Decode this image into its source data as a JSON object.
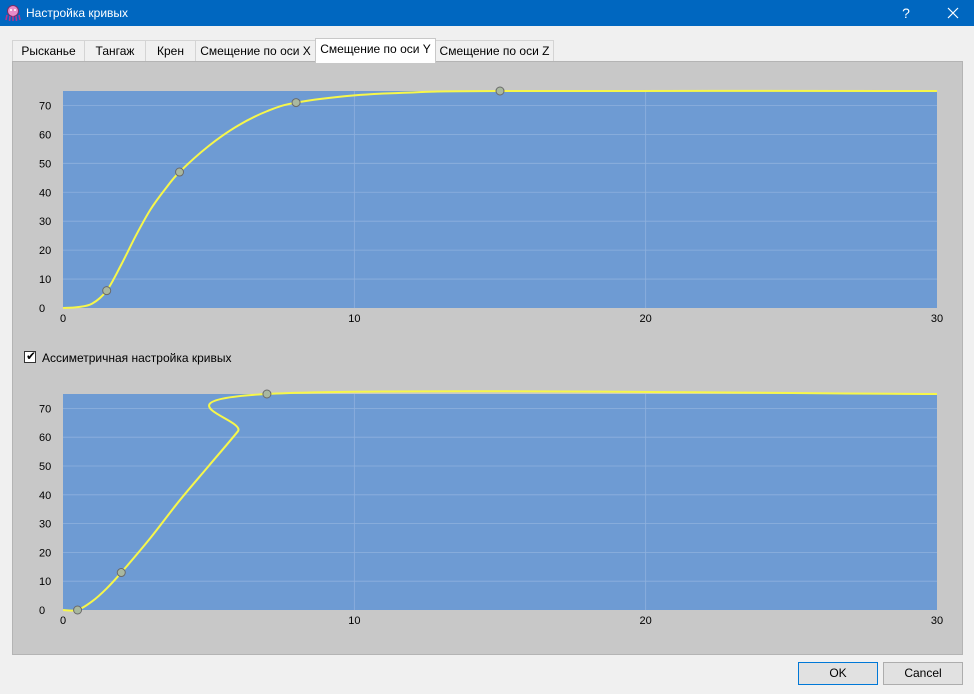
{
  "window": {
    "title": "Настройка кривых",
    "help_label": "?",
    "close_label": "✕"
  },
  "tabs": [
    {
      "label": "Рысканье",
      "active": false
    },
    {
      "label": "Тангаж",
      "active": false
    },
    {
      "label": "Крен",
      "active": false
    },
    {
      "label": "Смещение по оси X",
      "active": false
    },
    {
      "label": "Смещение по оси Y",
      "active": true
    },
    {
      "label": "Смещение по оси Z",
      "active": false
    }
  ],
  "asymmetric": {
    "label": "Ассиметричная настройка кривых",
    "checked": true,
    "mark": "✔"
  },
  "buttons": {
    "ok": "OK",
    "cancel": "Cancel"
  },
  "colors": {
    "plot_bg": "#6e9bd3",
    "curve": "#f7f74a",
    "point_fill": "#a9b8a0",
    "grid": "#8fb1de"
  },
  "chart_data": [
    {
      "type": "line",
      "title": "",
      "xlabel": "",
      "ylabel": "",
      "xlim": [
        0,
        30
      ],
      "ylim": [
        0,
        75
      ],
      "x_ticks": [
        0,
        10,
        20,
        30
      ],
      "y_ticks": [
        0,
        10,
        20,
        30,
        40,
        50,
        60,
        70
      ],
      "grid": true,
      "control_points": [
        {
          "x": 1.5,
          "y": 6
        },
        {
          "x": 4,
          "y": 47
        },
        {
          "x": 8,
          "y": 71
        },
        {
          "x": 15,
          "y": 75
        }
      ],
      "curve": {
        "x": [
          0,
          0.5,
          1,
          1.5,
          2,
          2.5,
          3,
          3.5,
          4,
          5,
          6,
          7,
          8,
          10,
          12,
          15,
          30
        ],
        "y": [
          0,
          0.3,
          1.5,
          6,
          15,
          25,
          34,
          41,
          47,
          56,
          63,
          68,
          71,
          73.5,
          74.5,
          75,
          75
        ]
      }
    },
    {
      "type": "line",
      "title": "",
      "xlabel": "",
      "ylabel": "",
      "xlim": [
        0,
        30
      ],
      "ylim": [
        0,
        75
      ],
      "x_ticks": [
        0,
        10,
        20,
        30
      ],
      "y_ticks": [
        0,
        10,
        20,
        30,
        40,
        50,
        60,
        70
      ],
      "grid": true,
      "control_points": [
        {
          "x": 0.5,
          "y": 0
        },
        {
          "x": 2,
          "y": 13
        },
        {
          "x": 7,
          "y": 75
        }
      ],
      "curve": {
        "x": [
          0,
          0.5,
          1,
          1.5,
          2,
          3,
          4,
          5,
          6,
          7,
          30
        ],
        "y": [
          0,
          0,
          3,
          7.5,
          13,
          25,
          38,
          50,
          62,
          75,
          75
        ]
      }
    }
  ]
}
